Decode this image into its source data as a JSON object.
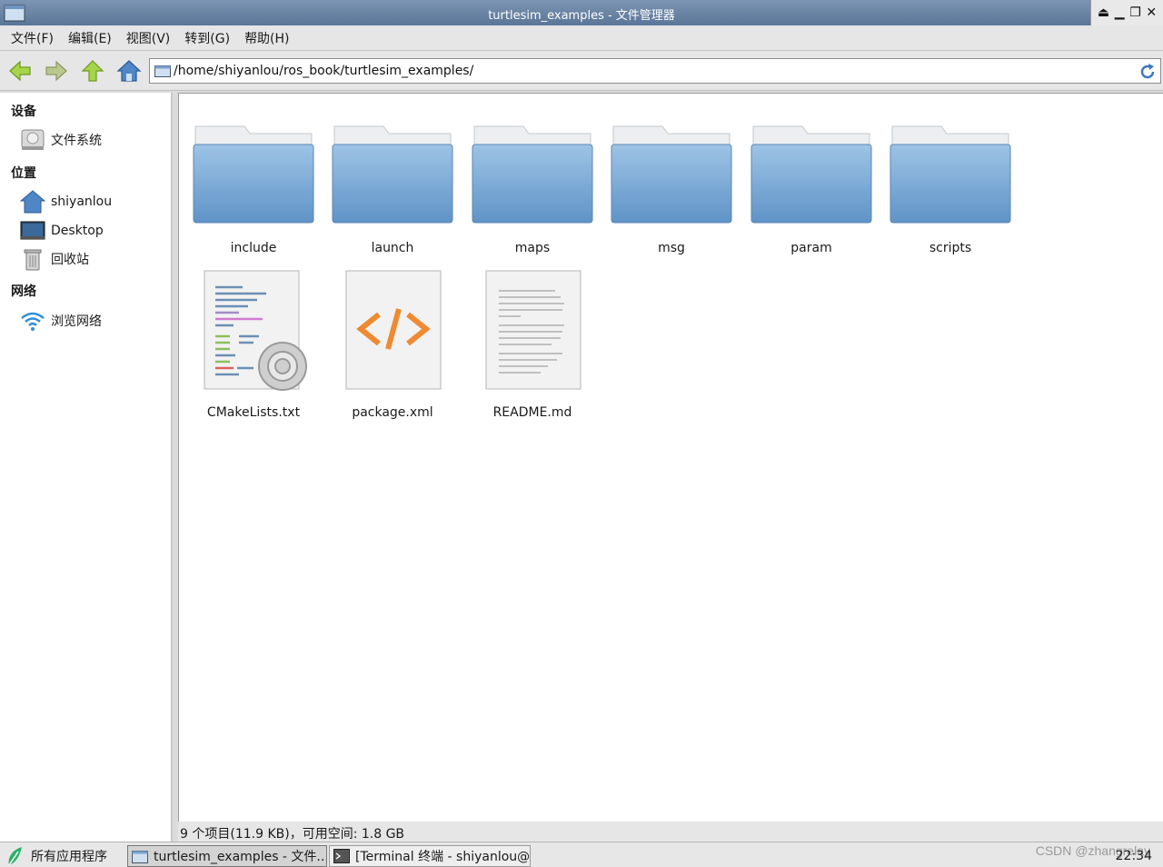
{
  "window": {
    "title": "turtlesim_examples - 文件管理器",
    "controls": {
      "eject": "⏏",
      "minimize": "▁",
      "restore": "❐",
      "close": "✕"
    }
  },
  "menubar": {
    "items": [
      "文件(F)",
      "编辑(E)",
      "视图(V)",
      "转到(G)",
      "帮助(H)"
    ]
  },
  "toolbar": {
    "icons": [
      "back-arrow-icon",
      "forward-arrow-icon",
      "up-arrow-icon",
      "home-icon",
      "reload-icon"
    ],
    "path": "/home/shiyanlou/ros_book/turtlesim_examples/"
  },
  "sidebar": {
    "sections": [
      {
        "header": "设备",
        "items": [
          {
            "label": "文件系统",
            "icon": "drive-icon"
          }
        ]
      },
      {
        "header": "位置",
        "items": [
          {
            "label": "shiyanlou",
            "icon": "home-icon"
          },
          {
            "label": "Desktop",
            "icon": "desktop-icon"
          },
          {
            "label": "回收站",
            "icon": "trash-icon"
          }
        ]
      },
      {
        "header": "网络",
        "items": [
          {
            "label": "浏览网络",
            "icon": "wifi-icon"
          }
        ]
      }
    ]
  },
  "files": {
    "folders": [
      "include",
      "launch",
      "maps",
      "msg",
      "param",
      "scripts"
    ],
    "documents": [
      {
        "name": "CMakeLists.txt",
        "icon": "cmake-file-icon"
      },
      {
        "name": "package.xml",
        "icon": "xml-file-icon"
      },
      {
        "name": "README.md",
        "icon": "text-file-icon"
      }
    ]
  },
  "status": {
    "text": "9 个项目(11.9 KB)，可用空间: 1.8 GB"
  },
  "taskbar": {
    "start_label": "所有应用程序",
    "tasks": [
      {
        "label": "turtlesim_examples - 文件...",
        "icon": "folder-icon",
        "active": true
      },
      {
        "label": "[Terminal 终端 - shiyanlou@···",
        "icon": "terminal-icon",
        "active": false
      }
    ],
    "clock": "22:34",
    "watermark": "CSDN @zhangrelay"
  },
  "colors": {
    "titlebar": "#5a7598",
    "folder": "#6fa0cf",
    "xml_accent": "#f08a32"
  }
}
